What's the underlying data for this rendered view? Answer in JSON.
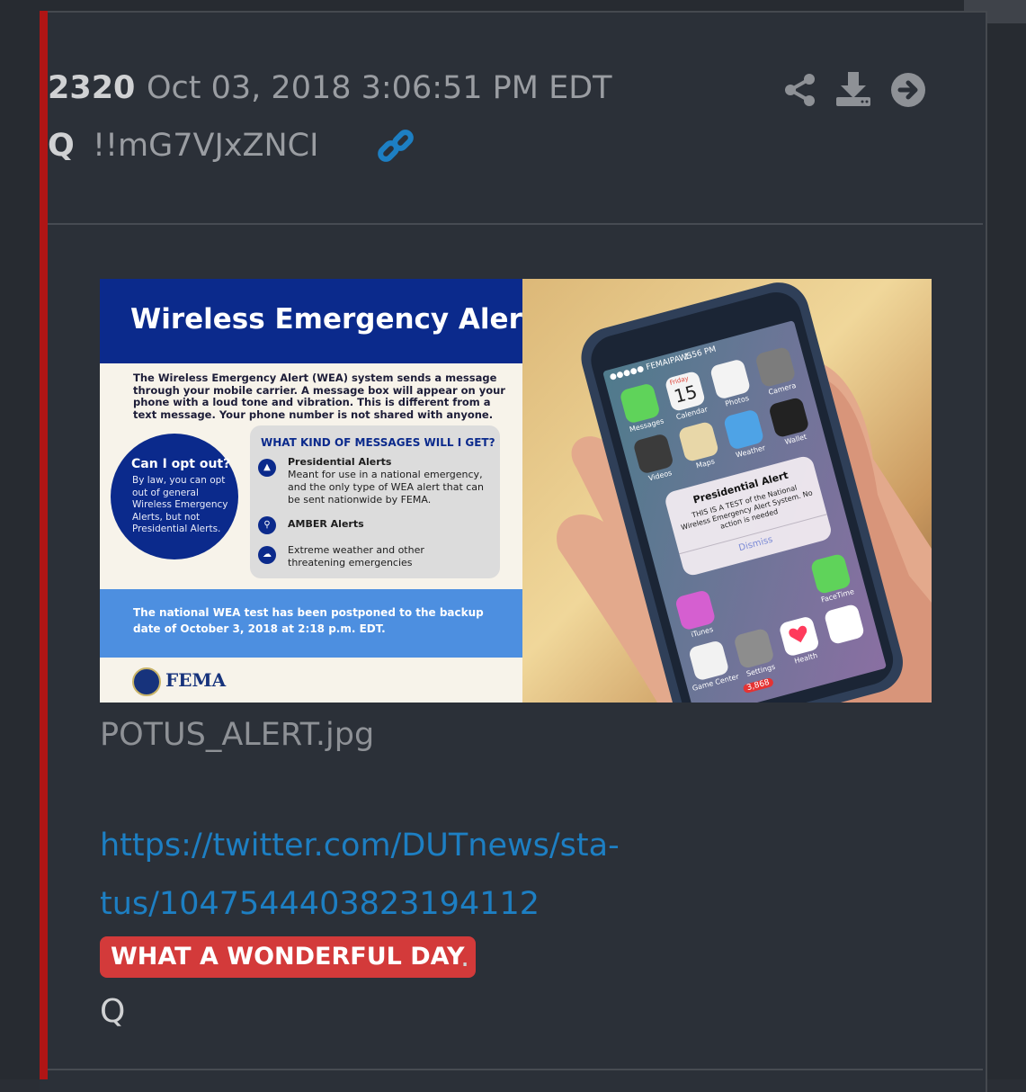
{
  "post": {
    "number": "2320",
    "date": "Oct 03, 2018 3:06:51 PM EDT",
    "author": "Q",
    "tripcode": "!!mG7VJxZNCI"
  },
  "toolbar": {
    "share_icon": "share-icon",
    "download_icon": "download-icon",
    "goto_icon": "arrow-right-circle-icon",
    "link_icon": "link-icon"
  },
  "attachment": {
    "filename": "POTUS_ALERT.jpg",
    "infographic": {
      "title": "Wireless Emergency Alert",
      "intro": "The Wireless Emergency Alert (WEA) system sends a message through your mobile carrier. A message box will appear on your phone with a loud tone and vibration. This is different from a text message. Your phone number is not shared with anyone.",
      "opt_out_title": "Can I opt out?",
      "opt_out_body": "By law, you can opt out of general Wireless Emergency Alerts, but not Presidential Alerts.",
      "messages_heading": "WHAT KIND OF MESSAGES WILL I GET?",
      "messages": [
        {
          "title": "Presidential Alerts",
          "body": "Meant for use in a national emergency, and the only type of WEA alert that can be sent nationwide by FEMA."
        },
        {
          "title": "AMBER Alerts",
          "body": ""
        },
        {
          "title": "Extreme weather and other threatening emergencies",
          "body": ""
        }
      ],
      "test_notice": "The national WEA test has been postponed to the backup date of October 3, 2018 at 2:18 p.m. EDT.",
      "agency": "FEMA"
    },
    "phone": {
      "carrier": "●●●●● FEMAIPAWS",
      "time": "1:56 PM",
      "calendar_day": "Friday",
      "calendar_date": "15",
      "apps_row1": [
        "Messages",
        "Calendar",
        "Photos",
        "Camera"
      ],
      "apps_row2": [
        "Videos",
        "Maps",
        "Weather",
        "Wallet"
      ],
      "apps_row3": [
        "iTunes",
        "",
        "",
        "FaceTime"
      ],
      "apps_row4": [
        "Game Center",
        "Settings",
        "Health",
        ""
      ],
      "badge_count": "3,868",
      "alert_title": "Presidential Alert",
      "alert_body": "THIS IS A TEST of the National Wireless Emergency Alert System. No action is needed",
      "alert_button": "Dismiss"
    }
  },
  "content": {
    "link": "https://twitter.com/DUTnews/sta-tus/1047544403823194112",
    "link_line1": "https://twitter.com/DUTnews/sta-",
    "link_line2": "tus/1047544403823194112",
    "highlight": "WHAT A WONDERFUL DAY",
    "highlight_suffix": ".",
    "signature": "Q"
  },
  "colors": {
    "background": "#2b3038",
    "accent_bar": "#b01515",
    "link": "#1d7fc3",
    "badge": "#d33a3a"
  }
}
